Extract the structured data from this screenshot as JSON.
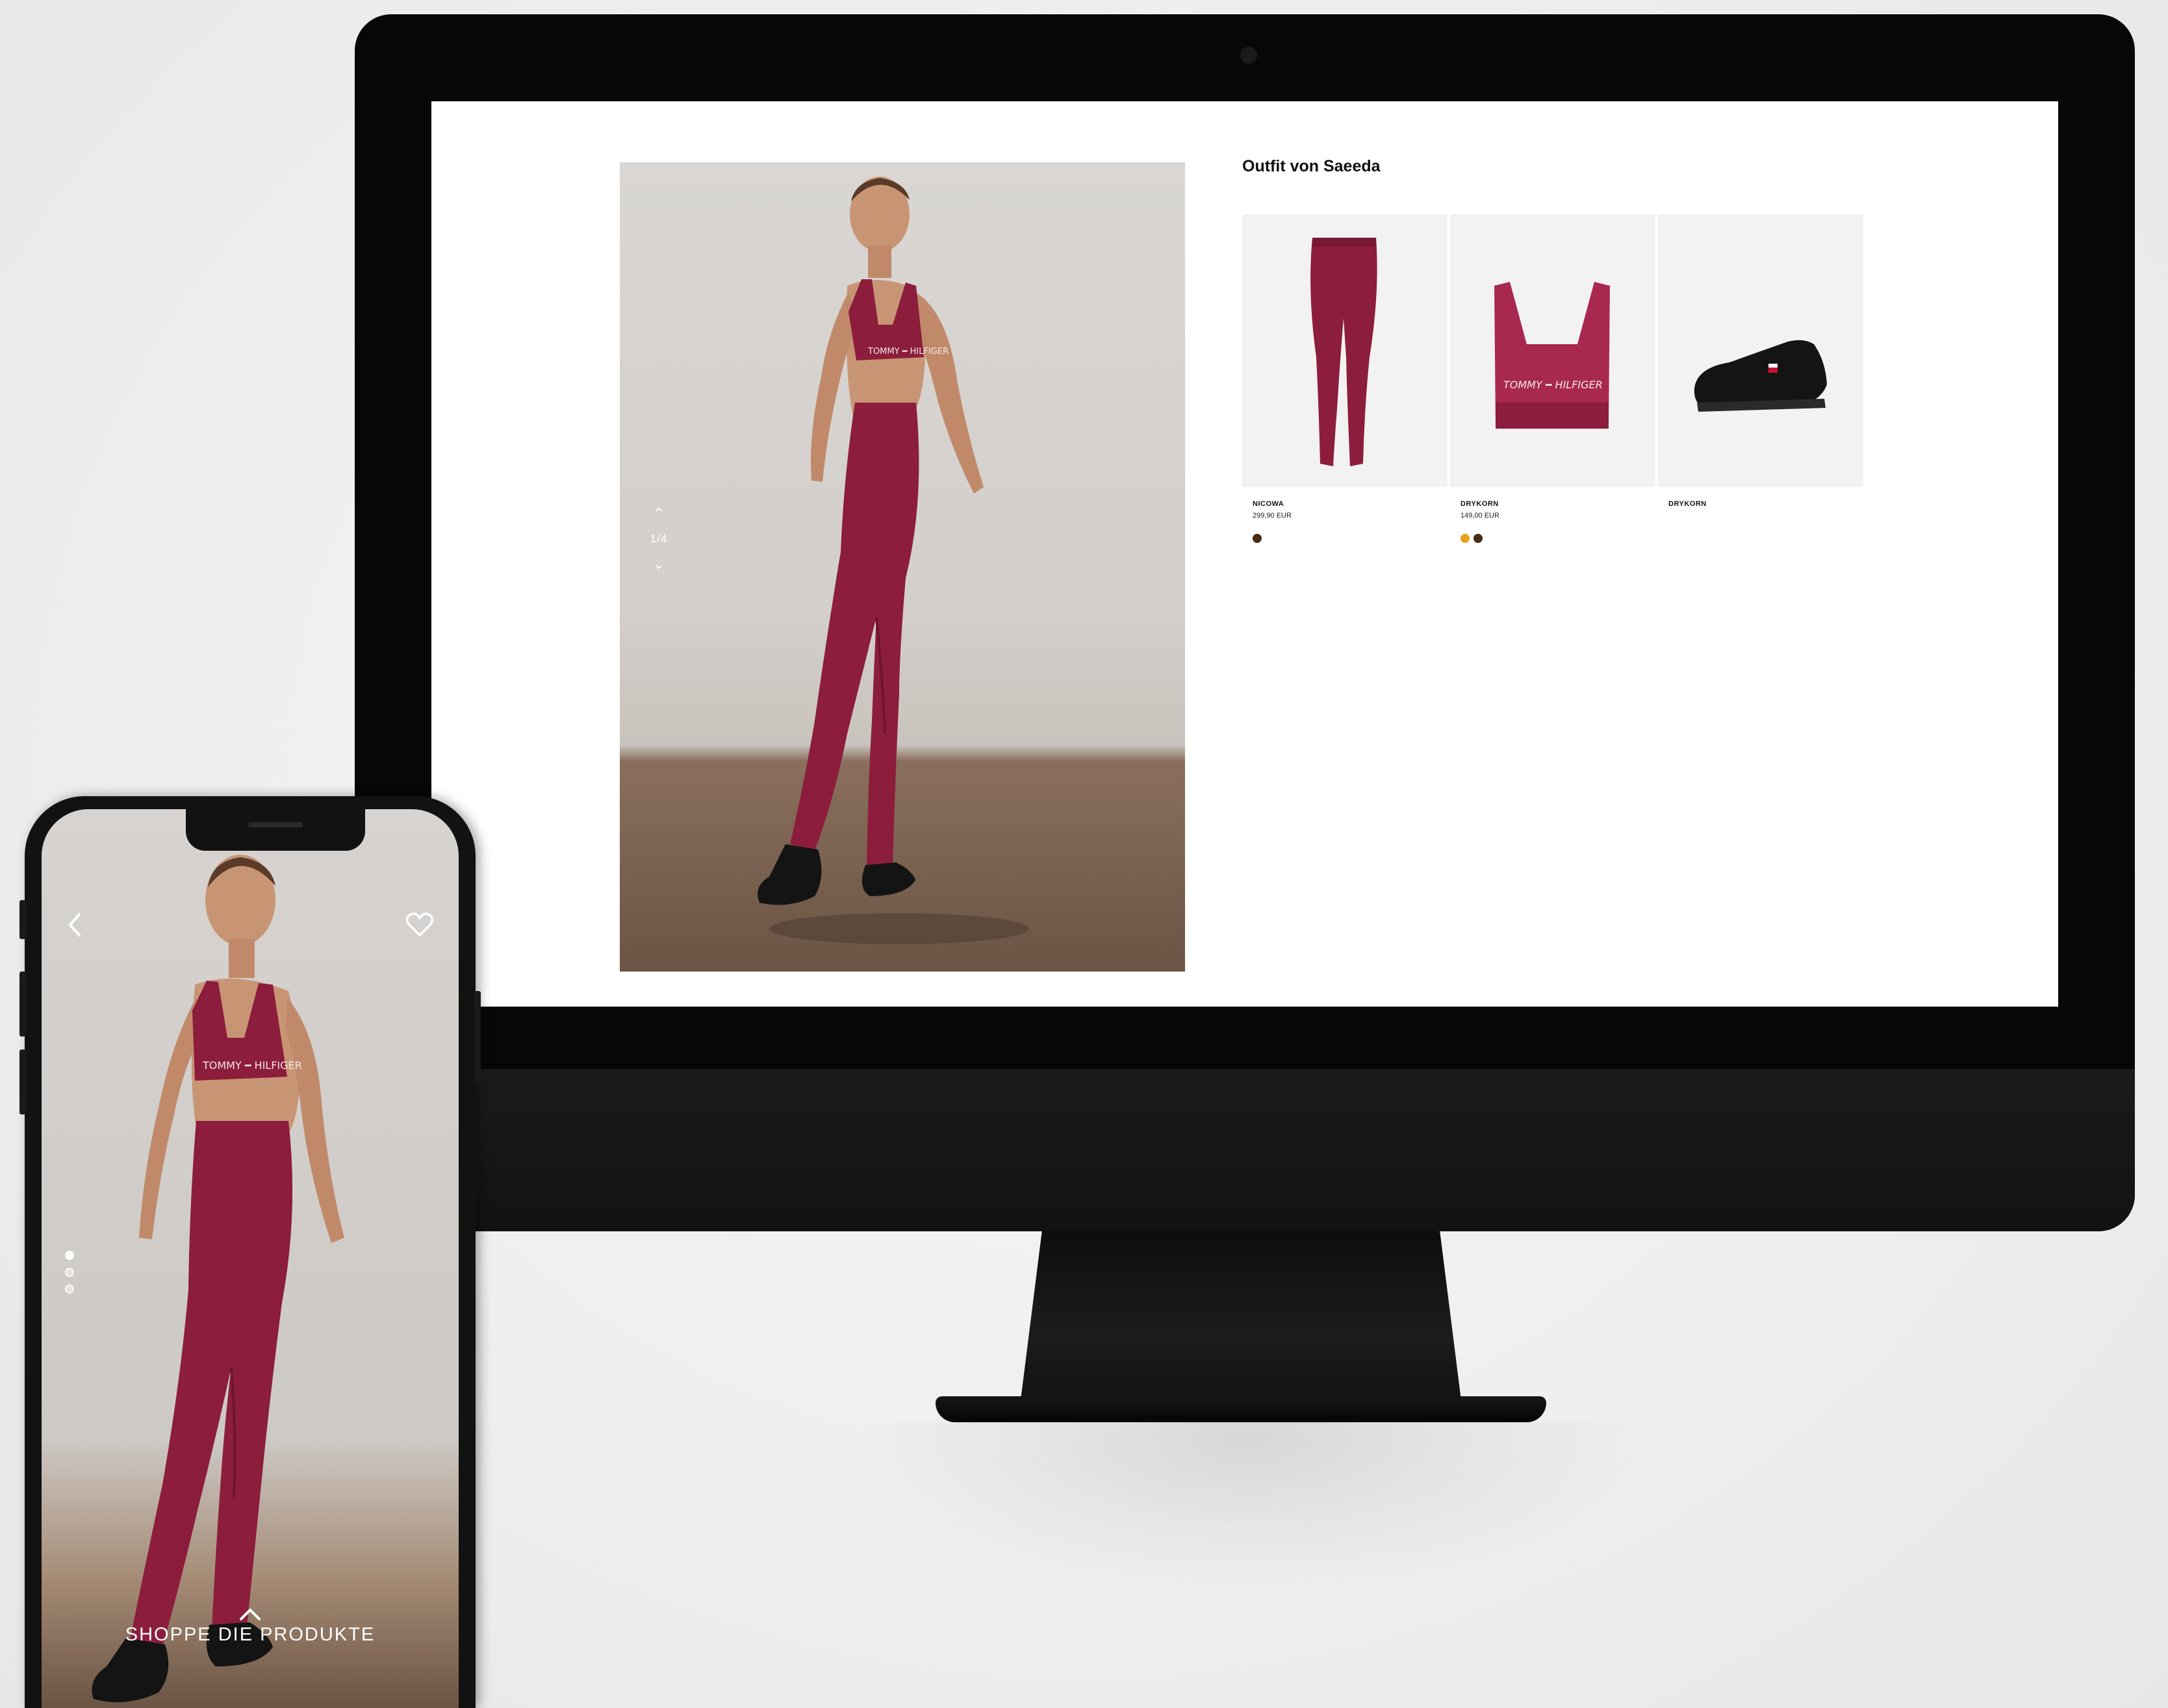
{
  "desktop": {
    "pager": {
      "up_glyph": "⌃",
      "counter": "1/4",
      "down_glyph": "⌄"
    },
    "outfit_title": "Outfit von Saeeda",
    "products": [
      {
        "brand": "NICOWA",
        "price": "299,90 EUR",
        "swatches": [
          "#4a2a12"
        ],
        "image": "leggings"
      },
      {
        "brand": "DRYKORN",
        "price": "149,00 EUR",
        "swatches": [
          "#e8a21c",
          "#4a2a12"
        ],
        "image": "sports-bra",
        "print": "TOMMY ━ HILFIGER"
      },
      {
        "brand": "DRYKORN",
        "price": "",
        "swatches": [],
        "image": "sneaker"
      }
    ]
  },
  "mobile": {
    "back_icon": "chevron-left-icon",
    "heart_icon": "heart-icon",
    "carousel_dots": {
      "count": 3,
      "active": 1
    },
    "cta_label": "SHOPPE DIE PRODUKTE"
  },
  "colors": {
    "garment": "#8c1d3c",
    "garment_shadow": "#6e1530",
    "shoe": "#141414",
    "swatch_brown": "#4a2a12",
    "swatch_yellow": "#e8a21c"
  }
}
